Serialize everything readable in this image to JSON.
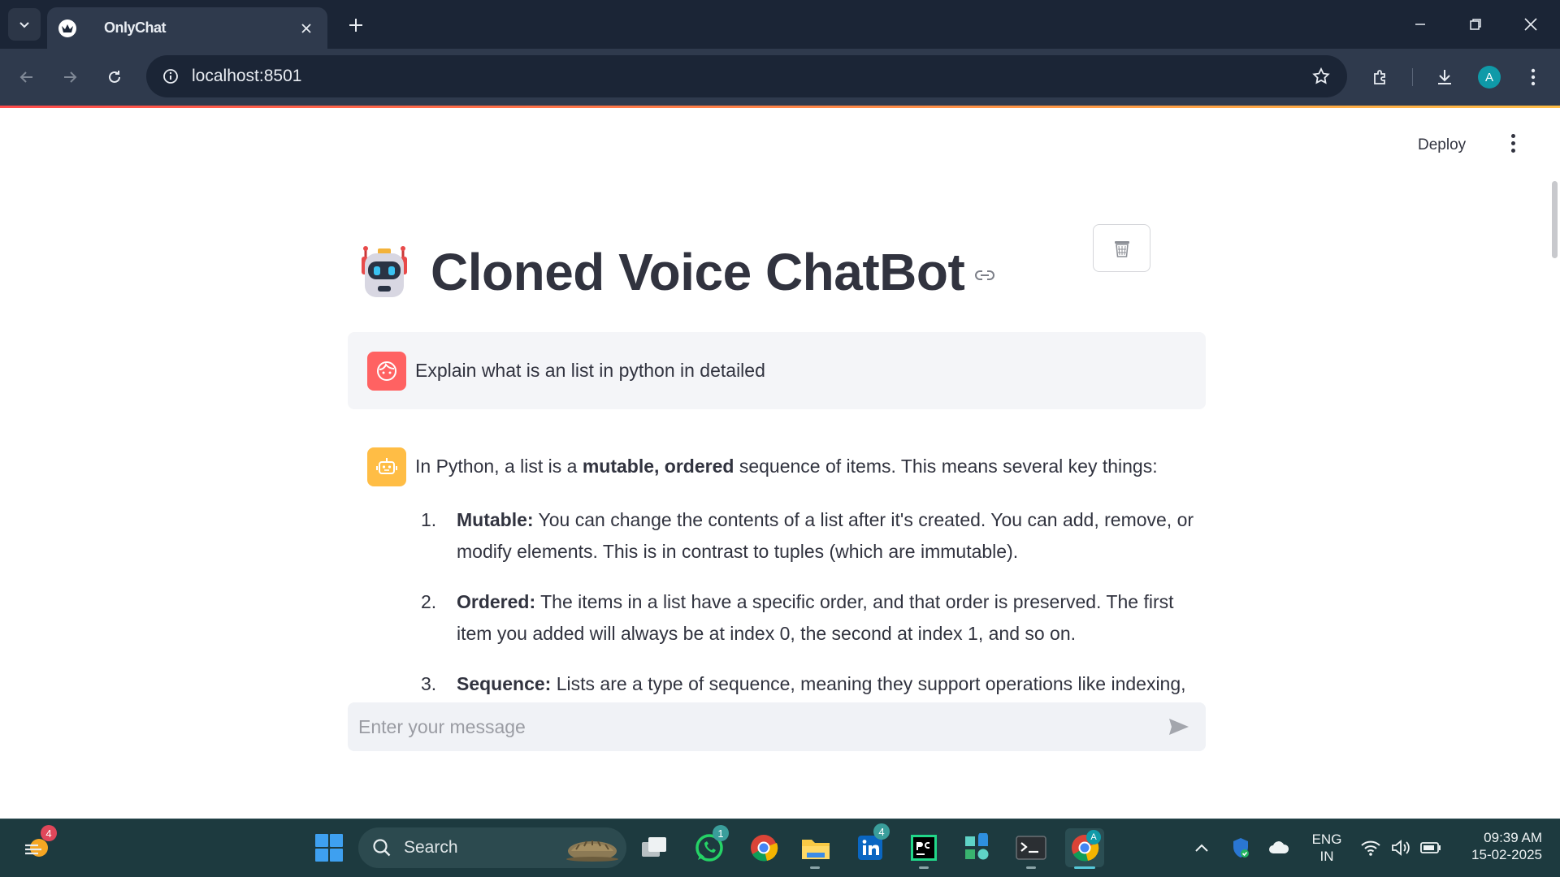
{
  "browser": {
    "tab_title": "OnlyChat",
    "url": "localhost:8501",
    "profile_initial": "A"
  },
  "app": {
    "deploy_label": "Deploy",
    "title": "Cloned Voice ChatBot",
    "user_message": "Explain what is an list in python in detailed",
    "bot": {
      "intro_pre": "In Python, a list is a ",
      "intro_b1": "mutable",
      "intro_sep": ", ",
      "intro_b2": "ordered",
      "intro_post": " sequence of items. This means several key things:",
      "items": [
        {
          "num": "1.",
          "term": "Mutable:",
          "text": " You can change the contents of a list after it's created. You can add, remove, or modify elements. This is in contrast to tuples (which are immutable)."
        },
        {
          "num": "2.",
          "term": "Ordered:",
          "text": " The items in a list have a specific order, and that order is preserved. The first item you added will always be at index 0, the second at index 1, and so on."
        },
        {
          "num": "3.",
          "term": "Sequence:",
          "text": " Lists are a type of sequence, meaning they support operations like indexing,"
        }
      ]
    },
    "input_placeholder": "Enter your message"
  },
  "taskbar": {
    "search_label": "Search",
    "weather_badge": "4",
    "whatsapp_badge": "1",
    "linkedin_badge": "4",
    "chrome_profile_badge": "A",
    "lang_line1": "ENG",
    "lang_line2": "IN",
    "time": "09:39 AM",
    "date": "15-02-2025"
  },
  "colors": {
    "accent": "#ff4b4b",
    "user_avatar": "#ff6262",
    "bot_avatar": "#ffbd45"
  }
}
